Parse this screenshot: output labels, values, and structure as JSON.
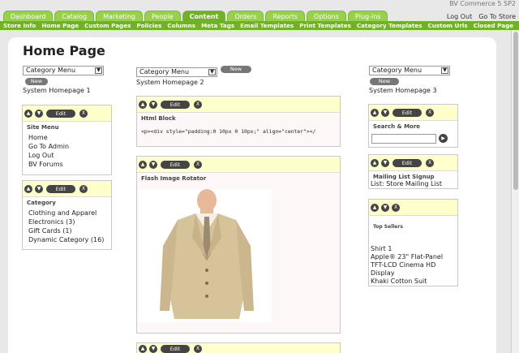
{
  "header": {
    "brand": "BV Commerce 5 SP2",
    "links": [
      "Log Out",
      "Go To Store"
    ],
    "tabs": [
      "Dashboard",
      "Catalog",
      "Marketing",
      "People",
      "Content",
      "Orders",
      "Reports",
      "Options",
      "Plug-ins"
    ],
    "active_tab": "Content",
    "subnav": [
      "Store Info",
      "Home Page",
      "Custom Pages",
      "Policies",
      "Columns",
      "Meta Tags",
      "Email Templates",
      "Print Templates",
      "Category Templates",
      "Custom Urls",
      "Closed Page"
    ]
  },
  "page": {
    "title": "Home Page",
    "select_value": "Category Menu",
    "new_label": "New",
    "edit_label": "Edit",
    "x_label": "X",
    "columns": [
      {
        "label": "System Homepage 1"
      },
      {
        "label": "System Homepage 2"
      },
      {
        "label": "System Homepage 3"
      }
    ]
  },
  "blocks": {
    "site_menu": {
      "title": "Site Menu",
      "links": [
        "Home",
        "Go To Admin",
        "Log Out",
        "BV Forums"
      ]
    },
    "category": {
      "title": "Category",
      "links": [
        "Clothing and Apparel",
        "Electronics (3)",
        "Gift Cards (1)",
        "Dynamic Category (16)"
      ]
    },
    "html_block": {
      "title": "Html Block",
      "code": "<p><div style=\"padding:0 10px 0 10px;\" align=\"center\"></"
    },
    "image_rotator": {
      "title": "Flash Image Rotator"
    },
    "search": {
      "title": "Search & More"
    },
    "mailing": {
      "title": "Mailing List Signup",
      "text": "List: Store Mailing List"
    },
    "top_sellers": {
      "title": "Top Sellers",
      "items": [
        "Shirt 1",
        "Apple® 23\" Flat-Panel",
        "TFT-LCD Cinema HD Display",
        "Khaki Cotton Suit"
      ]
    }
  },
  "colors": {
    "nav_green": "#6fb225",
    "tab_green": "#97d14a",
    "toolbar_yellow": "#ffffcc"
  }
}
